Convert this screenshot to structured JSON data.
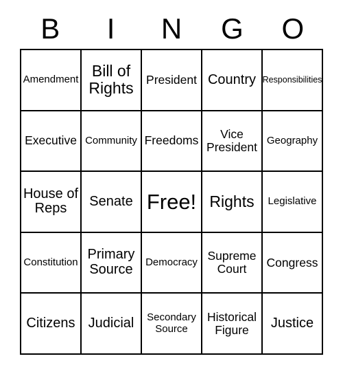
{
  "header": {
    "letters": [
      "B",
      "I",
      "N",
      "G",
      "O"
    ]
  },
  "grid": {
    "rows": [
      {
        "cells": [
          {
            "text": "Amendment",
            "size": "fs-s"
          },
          {
            "text": "Bill of Rights",
            "size": "fs-xl"
          },
          {
            "text": "President",
            "size": "fs-m"
          },
          {
            "text": "Country",
            "size": "fs-l"
          },
          {
            "text": "Responsibilities",
            "size": "fs-xs"
          }
        ]
      },
      {
        "cells": [
          {
            "text": "Executive",
            "size": "fs-m"
          },
          {
            "text": "Community",
            "size": "fs-s"
          },
          {
            "text": "Freedoms",
            "size": "fs-m"
          },
          {
            "text": "Vice President",
            "size": "fs-m"
          },
          {
            "text": "Geography",
            "size": "fs-s"
          }
        ]
      },
      {
        "cells": [
          {
            "text": "House of Reps",
            "size": "fs-l"
          },
          {
            "text": "Senate",
            "size": "fs-l"
          },
          {
            "text": "Free!",
            "size": "fs-free"
          },
          {
            "text": "Rights",
            "size": "fs-xl"
          },
          {
            "text": "Legislative",
            "size": "fs-s"
          }
        ]
      },
      {
        "cells": [
          {
            "text": "Constitution",
            "size": "fs-s"
          },
          {
            "text": "Primary Source",
            "size": "fs-l"
          },
          {
            "text": "Democracy",
            "size": "fs-s"
          },
          {
            "text": "Supreme Court",
            "size": "fs-m"
          },
          {
            "text": "Congress",
            "size": "fs-m"
          }
        ]
      },
      {
        "cells": [
          {
            "text": "Citizens",
            "size": "fs-l"
          },
          {
            "text": "Judicial",
            "size": "fs-l"
          },
          {
            "text": "Secondary Source",
            "size": "fs-s"
          },
          {
            "text": "Historical Figure",
            "size": "fs-m"
          },
          {
            "text": "Justice",
            "size": "fs-l"
          }
        ]
      }
    ]
  }
}
